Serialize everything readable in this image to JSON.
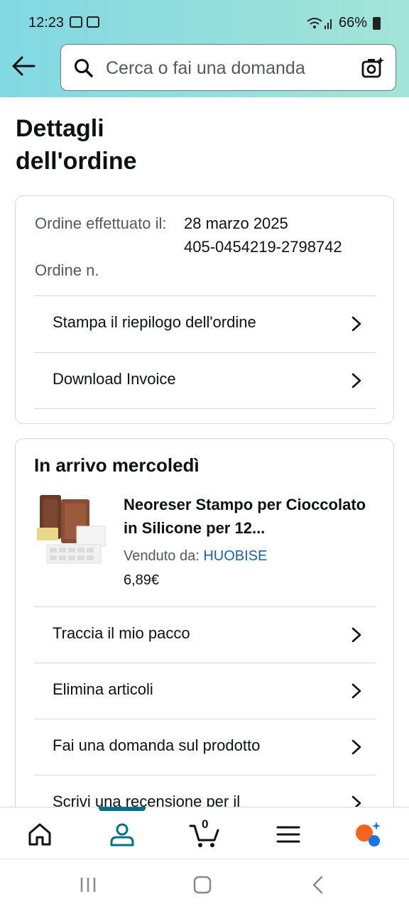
{
  "status_bar": {
    "time": "12:23",
    "battery": "66%"
  },
  "search": {
    "placeholder": "Cerca o fai una domanda"
  },
  "page": {
    "title": "Dettagli dell'ordine"
  },
  "order_info": {
    "date_label": "Ordine effettuato il:",
    "date_value": "28 marzo 2025",
    "number_label": "Ordine n.",
    "number_value": "405-0454219-2798742"
  },
  "order_actions": [
    {
      "label": "Stampa il riepilogo dell'ordine"
    },
    {
      "label": "Download Invoice"
    }
  ],
  "shipment": {
    "heading": "In arrivo mercoledì",
    "product": {
      "name": "Neoreser Stampo per Cioccolato in Silicone per 12...",
      "sold_by_label": "Venduto da:",
      "seller": "HUOBISE",
      "price": "6,89€"
    },
    "actions": [
      {
        "label": "Traccia il mio pacco"
      },
      {
        "label": "Elimina articoli"
      },
      {
        "label": "Fai una domanda sul prodotto"
      },
      {
        "label": "Scrivi una recensione per il"
      }
    ]
  },
  "bottom_nav": {
    "items": [
      "home-icon",
      "account-icon",
      "cart-icon",
      "menu-icon",
      "assistant-icon"
    ],
    "cart_count": "0",
    "active": "account-icon"
  },
  "colors": {
    "accent": "#007185",
    "link": "#2162a1",
    "header_gradient_start": "#82d8e3",
    "header_gradient_end": "#a3e4d6"
  }
}
